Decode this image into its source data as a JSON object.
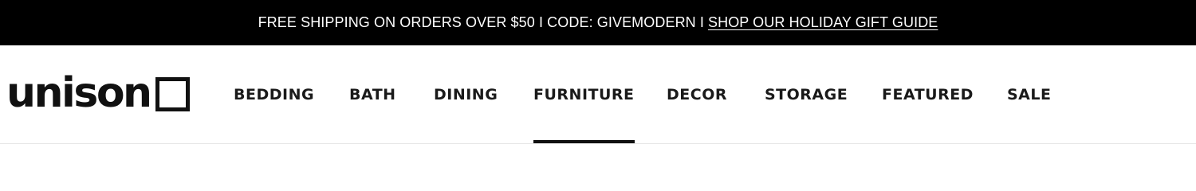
{
  "promo": {
    "text": "FREE SHIPPING ON ORDERS OVER $50 I CODE: GIVEMODERN I",
    "link_label": "SHOP OUR HOLIDAY GIFT GUIDE"
  },
  "logo": {
    "text": "unison"
  },
  "nav": {
    "items": [
      {
        "label": "BEDDING"
      },
      {
        "label": "BATH"
      },
      {
        "label": "DINING"
      },
      {
        "label": "FURNITURE"
      },
      {
        "label": "DECOR"
      },
      {
        "label": "STORAGE"
      },
      {
        "label": "FEATURED"
      },
      {
        "label": "SALE"
      }
    ],
    "active": "FURNITURE"
  }
}
